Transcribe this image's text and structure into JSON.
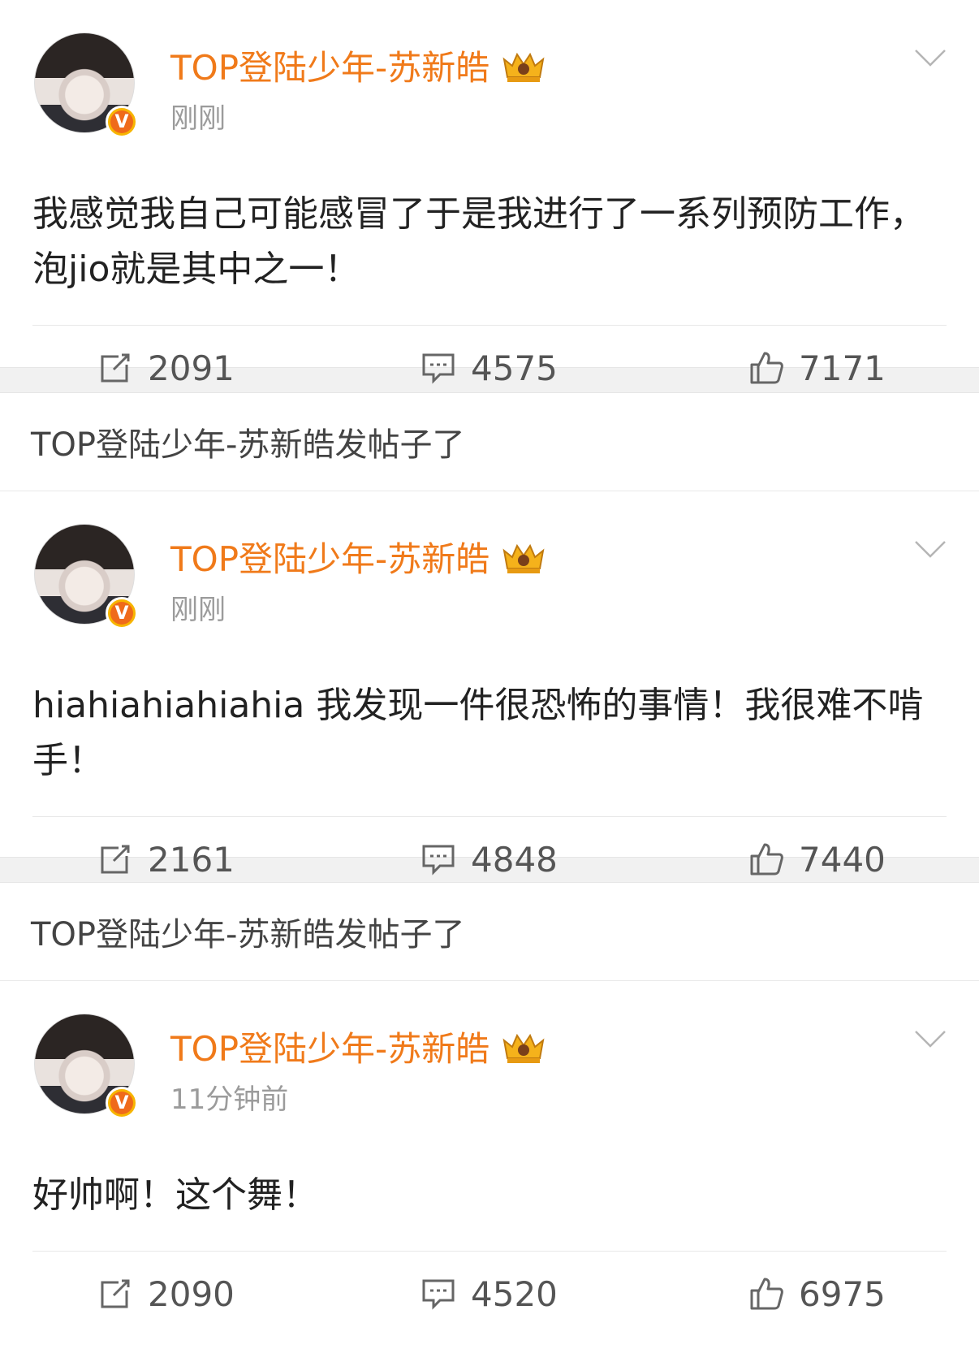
{
  "section_header": "TOP登陆少年-苏新皓发帖子了",
  "posts": [
    {
      "user_name": "TOP登陆少年-苏新皓",
      "time": "刚刚",
      "text": "我感觉我自己可能感冒了于是我进行了一系列预防工作，泡jio就是其中之一！",
      "reposts": "2091",
      "comments": "4575",
      "likes": "7171"
    },
    {
      "user_name": "TOP登陆少年-苏新皓",
      "time": "刚刚",
      "text": "hiahiahiahiahia 我发现一件很恐怖的事情！我很难不啃手！",
      "reposts": "2161",
      "comments": "4848",
      "likes": "7440"
    },
    {
      "user_name": "TOP登陆少年-苏新皓",
      "time": "11分钟前",
      "text": "好帅啊！这个舞！",
      "reposts": "2090",
      "comments": "4520",
      "likes": "6975"
    }
  ],
  "colors": {
    "accent": "#f07a1a",
    "badge": "#f7b500",
    "muted": "#9b9b9b"
  },
  "icons": [
    "avatar",
    "verified-v-icon",
    "crown-icon",
    "chevron-down-icon",
    "repost-icon",
    "comment-icon",
    "like-icon"
  ]
}
